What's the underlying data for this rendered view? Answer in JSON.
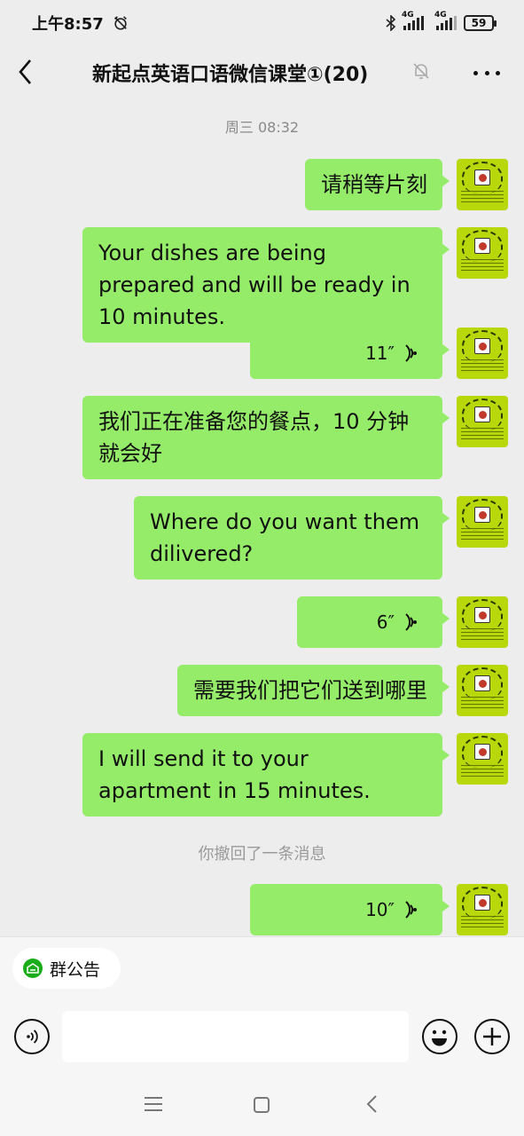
{
  "status_bar": {
    "time": "上午8:57",
    "network_1": "4G",
    "network_2": "4G",
    "battery": "59"
  },
  "header": {
    "title": "新起点英语口语微信课堂①(20)"
  },
  "chat": {
    "timestamp": "周三 08:32",
    "messages": [
      {
        "type": "text",
        "text": "请稍等片刻"
      },
      {
        "type": "text",
        "text": "Your dishes are being prepared and will be ready in 10 minutes."
      },
      {
        "type": "voice",
        "duration": "11″"
      },
      {
        "type": "text",
        "text": "我们正在准备您的餐点，10 分钟就会好"
      },
      {
        "type": "text",
        "text": "Where do you want them dilivered?"
      },
      {
        "type": "voice",
        "duration": "6″"
      },
      {
        "type": "text",
        "text": "需要我们把它们送到哪里"
      },
      {
        "type": "text",
        "text": "I will send it to your apartment in 15 minutes."
      },
      {
        "type": "voice",
        "duration": "10″"
      }
    ],
    "recall_notice": "你撤回了一条消息"
  },
  "group_notice_label": "群公告",
  "input": {
    "placeholder": ""
  },
  "colors": {
    "bubble": "#95ec69",
    "background": "#ededed",
    "accent": "#1aad19"
  }
}
